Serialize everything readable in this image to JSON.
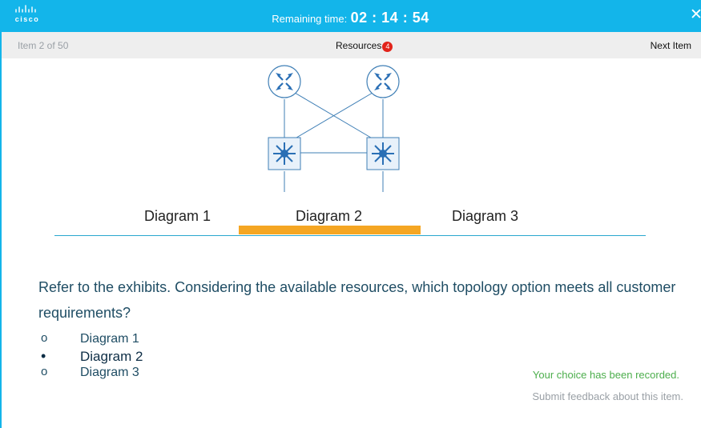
{
  "header": {
    "logo_text": "cisco",
    "timer_label": "Remaining time:",
    "timer_value": "02 : 14 : 54",
    "close_glyph": "✕"
  },
  "subbar": {
    "item_counter": "Item 2 of 50",
    "resources_label": "Resources",
    "resources_count": "4",
    "next_label": "Next Item"
  },
  "tabs": [
    {
      "label": "Diagram 1"
    },
    {
      "label": "Diagram 2",
      "selected": true
    },
    {
      "label": "Diagram 3"
    }
  ],
  "question": {
    "text": "Refer to the exhibits. Considering the available resources, which topology option meets all customer requirements?",
    "options": [
      {
        "marker": "o",
        "label": "Diagram 1"
      },
      {
        "marker": "•",
        "label": "Diagram 2",
        "selected": true
      },
      {
        "marker": "o",
        "label": "Diagram 3"
      }
    ]
  },
  "status": {
    "recorded": "Your choice has been recorded.",
    "feedback_link": "Submit feedback about this item."
  },
  "colors": {
    "accent": "#13b5ea",
    "tab_active": "#f5a623",
    "question_text": "#1f4d64",
    "recorded_green": "#4cae4c",
    "badge_red": "#e2231a"
  },
  "icons": [
    "cisco-logo-icon",
    "close-icon",
    "router-icon",
    "multilayer-switch-icon"
  ]
}
